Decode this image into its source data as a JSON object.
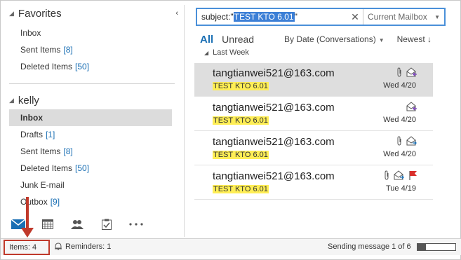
{
  "favorites": {
    "title": "Favorites",
    "items": [
      {
        "label": "Inbox",
        "count": ""
      },
      {
        "label": "Sent Items",
        "count": "[8]"
      },
      {
        "label": "Deleted Items",
        "count": "[50]"
      }
    ]
  },
  "account": {
    "title": "kelly",
    "items": [
      {
        "label": "Inbox",
        "count": ""
      },
      {
        "label": "Drafts",
        "count": "[1]"
      },
      {
        "label": "Sent Items",
        "count": "[8]"
      },
      {
        "label": "Deleted Items",
        "count": "[50]"
      },
      {
        "label": "Junk E-mail",
        "count": ""
      },
      {
        "label": "Outbox",
        "count": "[9]"
      }
    ]
  },
  "search": {
    "prefix": "subject:\"",
    "term": "TEST KTO 6.01",
    "suffix": "\"",
    "scope": "Current Mailbox"
  },
  "filters": {
    "all": "All",
    "unread": "Unread",
    "sort_by": "By Date (Conversations)",
    "sort_order": "Newest"
  },
  "group_header": "Last Week",
  "messages": [
    {
      "sender": "tangtianwei521@163.com",
      "subject": "TEST KTO 6.01",
      "date": "Wed 4/20"
    },
    {
      "sender": "tangtianwei521@163.com",
      "subject": "TEST KTO 6.01",
      "date": "Wed 4/20"
    },
    {
      "sender": "tangtianwei521@163.com",
      "subject": "TEST KTO 6.01",
      "date": "Wed 4/20"
    },
    {
      "sender": "tangtianwei521@163.com",
      "subject": "TEST KTO 6.01",
      "date": "Tue 4/19"
    }
  ],
  "status": {
    "items": "Items: 4",
    "reminders": "Reminders: 1",
    "sending": "Sending message 1 of 6",
    "progress_fraction": 0.22
  },
  "colors": {
    "accent": "#1a6fb4",
    "highlight": "#ffee55",
    "annotation": "#c0392b",
    "flag": "#d9302c"
  }
}
